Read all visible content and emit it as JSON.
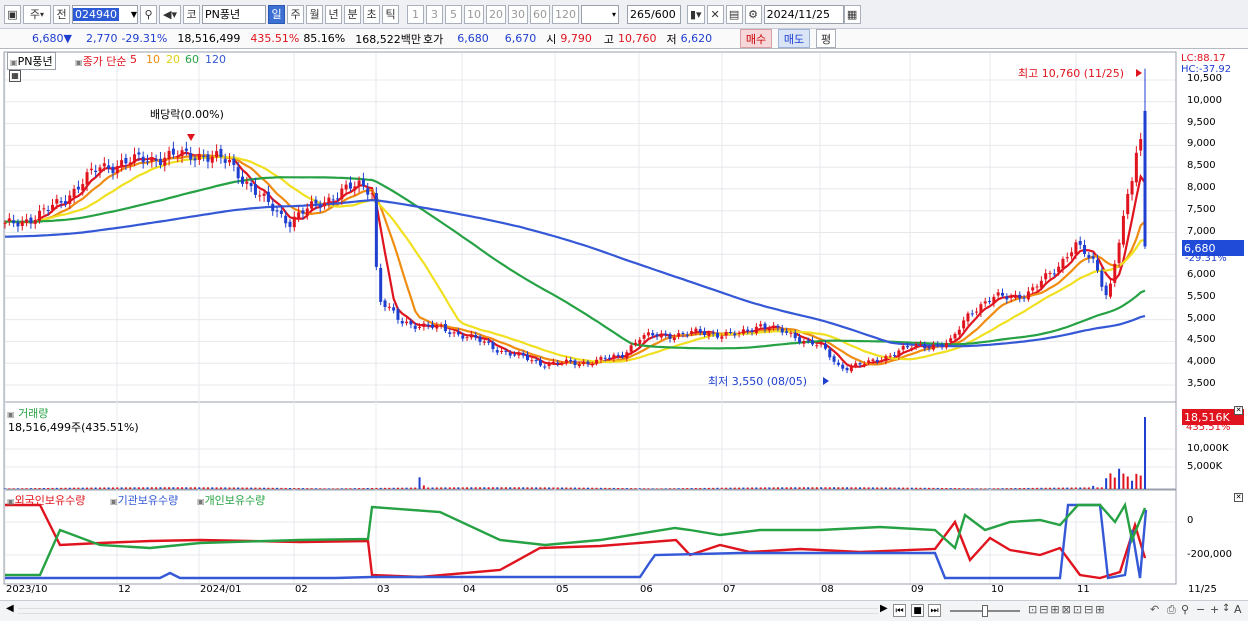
{
  "toolbar": {
    "market": "주",
    "period_type": "전",
    "code": "024940",
    "stock_name": "PN풍년",
    "market_btn": "코",
    "periods": [
      "일",
      "주",
      "월",
      "년",
      "분",
      "초",
      "틱"
    ],
    "numbers": [
      "1",
      "3",
      "5",
      "10",
      "20",
      "30",
      "60",
      "120"
    ],
    "count": "265",
    "count_total": "/600",
    "date": "2024/11/25"
  },
  "quote": {
    "price": "6,680▼",
    "change": "2,770",
    "change_pct": "-29.31%",
    "volume": "18,516,499",
    "vol_pct": "435.51%",
    "turnover": "85.16%",
    "amount": "168,522백만",
    "bid_label": "호가",
    "bid1": "6,680",
    "bid2": "6,670",
    "open_label": "시",
    "open": "9,790",
    "high_label": "고",
    "high": "10,760",
    "low_label": "저",
    "low": "6,620",
    "buy": "매수",
    "sell": "매도",
    "eval": "평"
  },
  "price_panel": {
    "name": "PN풍년",
    "legend_title": "종가 단순",
    "ma": [
      "5",
      "10",
      "20",
      "60",
      "120"
    ],
    "ma_colors": [
      "#e0141e",
      "#f08c10",
      "#f0e020",
      "#26a244",
      "#3558d6"
    ],
    "lc": "LC:88.17",
    "hc": "HC:-37.92",
    "y_ticks": [
      "10,500",
      "10,000",
      "9,500",
      "9,000",
      "8,500",
      "8,000",
      "7,500",
      "7,000",
      "6,500",
      "6,000",
      "5,500",
      "5,000",
      "4,500",
      "4,000",
      "3,500"
    ],
    "last_price": "6,680",
    "last_pct": "-29.31%",
    "high_note": "최고 10,760 (11/25)",
    "low_note": "최저 3,550 (08/05)",
    "dividend": "배당락(0.00%)"
  },
  "volume_panel": {
    "title": "거래량",
    "value": "18,516,499주(435.51%)",
    "y_ticks": [
      "10,000K",
      "5,000K"
    ],
    "box": "18,516K",
    "box_pct": "435.51%"
  },
  "holdings_panel": {
    "legend": [
      "외국인보유수량",
      "기관보유수량",
      "개인보유수량"
    ],
    "colors": [
      "#e0141e",
      "#3558d6",
      "#26a244"
    ],
    "y_ticks": [
      "0",
      "-200,000"
    ]
  },
  "x_axis": [
    "2023/10",
    "12",
    "2024/01",
    "02",
    "03",
    "04",
    "05",
    "06",
    "07",
    "08",
    "09",
    "10",
    "11",
    "11/25"
  ]
}
